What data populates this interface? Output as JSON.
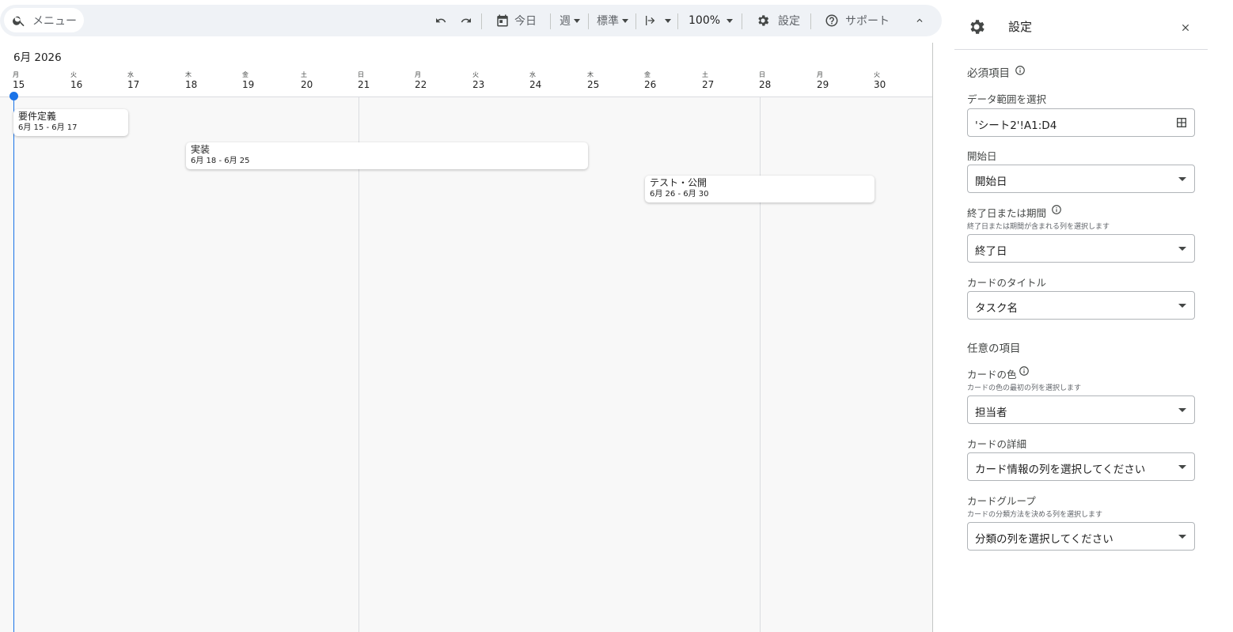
{
  "toolbar": {
    "search_label": "メニュー",
    "today_label": "今日",
    "scale_label": "週",
    "density_label": "標準",
    "zoom_label": "100%",
    "settings_label": "設定",
    "support_label": "サポート"
  },
  "timeline": {
    "month_label": "6月 2026",
    "days": [
      {
        "dow": "月",
        "num": "15"
      },
      {
        "dow": "火",
        "num": "16"
      },
      {
        "dow": "水",
        "num": "17"
      },
      {
        "dow": "木",
        "num": "18"
      },
      {
        "dow": "金",
        "num": "19"
      },
      {
        "dow": "土",
        "num": "20"
      },
      {
        "dow": "日",
        "num": "21"
      },
      {
        "dow": "月",
        "num": "22"
      },
      {
        "dow": "火",
        "num": "23"
      },
      {
        "dow": "水",
        "num": "24"
      },
      {
        "dow": "木",
        "num": "25"
      },
      {
        "dow": "金",
        "num": "26"
      },
      {
        "dow": "土",
        "num": "27"
      },
      {
        "dow": "日",
        "num": "28"
      },
      {
        "dow": "月",
        "num": "29"
      },
      {
        "dow": "火",
        "num": "30"
      }
    ],
    "cards": [
      {
        "title": "要件定義",
        "dates": "6月 15 - 6月 17"
      },
      {
        "title": "実装",
        "dates": "6月 18 - 6月 25"
      },
      {
        "title": "テスト・公開",
        "dates": "6月 26 - 6月 30"
      }
    ],
    "today_color": "#1a73e8"
  },
  "panel": {
    "title": "設定",
    "required_section": "必須項目",
    "range_label": "データ範囲を選択",
    "range_value": "'シート2'!A1:D4",
    "start_label": "開始日",
    "start_value": "開始日",
    "end_label": "終了日または期間",
    "end_hint": "終了日または期間が含まれる列を選択します",
    "end_value": "終了日",
    "card_title_label": "カードのタイトル",
    "card_title_value": "タスク名",
    "optional_section": "任意の項目",
    "color_label": "カードの色",
    "color_hint": "カードの色の最初の列を選択します",
    "color_value": "担当者",
    "details_label": "カードの詳細",
    "details_value": "カード情報の列を選択してください",
    "group_label": "カードグループ",
    "group_hint": "カードの分類方法を決める列を選択します",
    "group_value": "分類の列を選択してください"
  }
}
